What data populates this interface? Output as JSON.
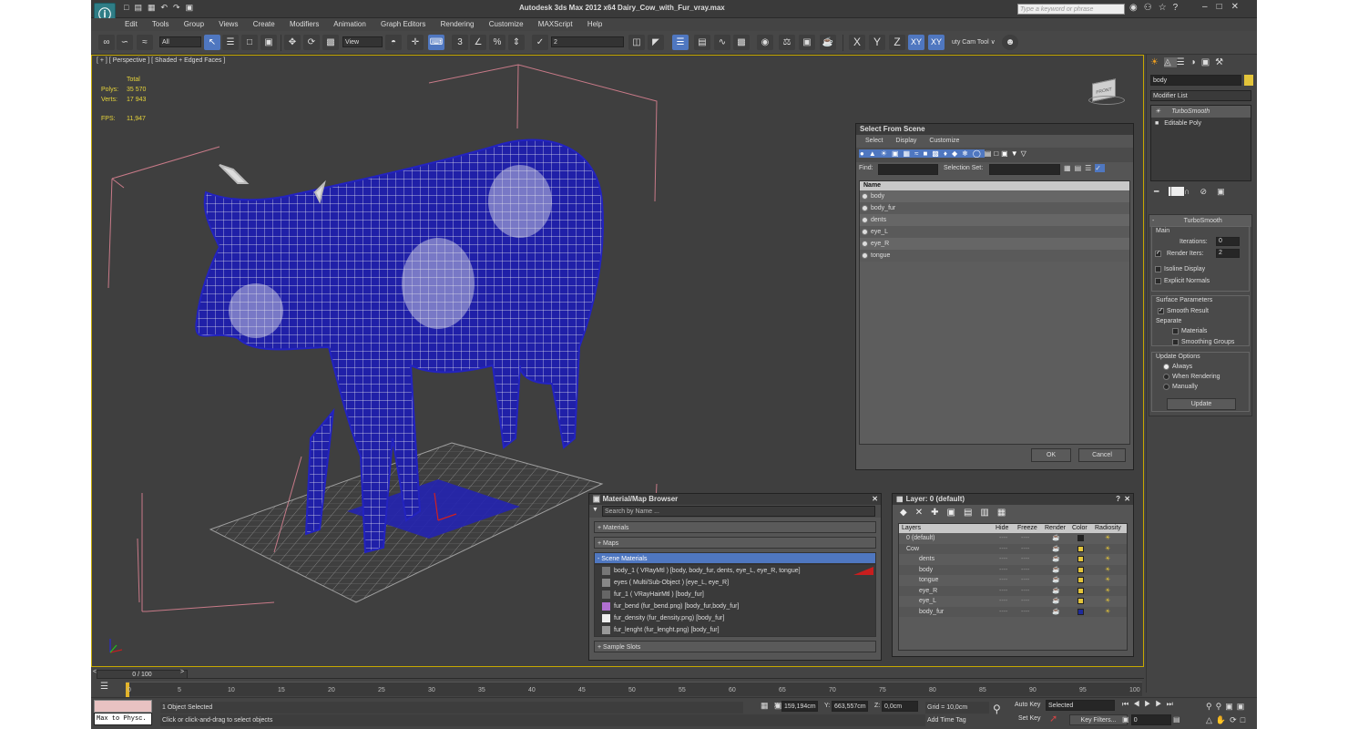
{
  "app": {
    "title": "Autodesk 3ds Max  2012 x64     Dairy_Cow_with_Fur_vray.max",
    "search_placeholder": "Type a keyword or phrase"
  },
  "menu": [
    "Edit",
    "Tools",
    "Group",
    "Views",
    "Create",
    "Modifiers",
    "Animation",
    "Graph Editors",
    "Rendering",
    "Customize",
    "MAXScript",
    "Help"
  ],
  "toolbar": {
    "filter": "All",
    "ref_coord": "View",
    "named_sel": "2",
    "axes": [
      "X",
      "Y",
      "Z",
      "XY",
      "XY"
    ],
    "extra": "uty Cam Tool ∨"
  },
  "viewport": {
    "label": "[ + ] [ Perspective ] [ Shaded + Edged Faces ]",
    "stats": {
      "header": "Total",
      "polys_label": "Polys:",
      "polys": "35 570",
      "verts_label": "Verts:",
      "verts": "17 943",
      "fps_label": "FPS:",
      "fps": "11,947"
    },
    "viewcube": "FRONT"
  },
  "select_scene": {
    "title": "Select From Scene",
    "menu": [
      "Select",
      "Display",
      "Customize"
    ],
    "find_label": "Find:",
    "selset_label": "Selection Set:",
    "col_name": "Name",
    "items": [
      "body",
      "body_fur",
      "dents",
      "eye_L",
      "eye_R",
      "tongue"
    ],
    "ok": "OK",
    "cancel": "Cancel"
  },
  "material_browser": {
    "title": "Material/Map Browser",
    "search": "Search by Name ...",
    "sections": [
      "+ Materials",
      "+ Maps",
      "- Scene Materials"
    ],
    "sample_slots": "+ Sample Slots",
    "items": [
      "body_1  ( VRayMtl ) [body, body_fur, dents, eye_L, eye_R, tongue]",
      "eyes  ( Multi/Sub-Object ) [eye_L, eye_R]",
      "fur_1  ( VRayHairMtl ) [body_fur]",
      "fur_bend (fur_bend.png) [body_fur,body_fur]",
      "fur_density (fur_density.png) [body_fur]",
      "fur_lenght (fur_lenght.png) [body_fur]"
    ]
  },
  "layer_manager": {
    "title": "Layer: 0 (default)",
    "help": "?",
    "columns": [
      "Layers",
      "Hide",
      "Freeze",
      "Render",
      "Color",
      "Radiosity"
    ],
    "rows": [
      {
        "name": "0 (default)",
        "indent": 0,
        "color": "#222222"
      },
      {
        "name": "Cow",
        "indent": 0,
        "color": "#e3c43a"
      },
      {
        "name": "dents",
        "indent": 1,
        "color": "#e3c43a"
      },
      {
        "name": "body",
        "indent": 1,
        "color": "#e3c43a"
      },
      {
        "name": "tongue",
        "indent": 1,
        "color": "#e3c43a"
      },
      {
        "name": "eye_R",
        "indent": 1,
        "color": "#e3c43a"
      },
      {
        "name": "eye_L",
        "indent": 1,
        "color": "#e3c43a"
      },
      {
        "name": "body_fur",
        "indent": 1,
        "color": "#1e2a9c"
      }
    ],
    "dash": "----"
  },
  "command_panel": {
    "object_name": "body",
    "modifier_list": "Modifier List",
    "stack": [
      "TurboSmooth",
      "Editable Poly"
    ],
    "rollout_title": "TurboSmooth",
    "main": "Main",
    "iterations_label": "Iterations:",
    "iterations": "0",
    "render_iters_label": "Render Iters:",
    "render_iters": "2",
    "isoline": "Isoline Display",
    "explicit": "Explicit Normals",
    "surface": "Surface Parameters",
    "smooth_result": "Smooth Result",
    "separate": "Separate",
    "materials": "Materials",
    "smoothing_groups": "Smoothing Groups",
    "update_options": "Update Options",
    "always": "Always",
    "when_rendering": "When Rendering",
    "manually": "Manually",
    "update": "Update"
  },
  "timeline": {
    "frame": "0 / 100",
    "ticks": [
      "0",
      "5",
      "10",
      "15",
      "20",
      "25",
      "30",
      "35",
      "40",
      "45",
      "50",
      "55",
      "60",
      "65",
      "70",
      "75",
      "80",
      "85",
      "90",
      "95",
      "100"
    ]
  },
  "status": {
    "selected": "1 Object Selected",
    "prompt": "Click or click-and-drag to select objects",
    "listener": "Max to Physc.",
    "x_label": "X:",
    "x": "159,194cm",
    "y_label": "Y:",
    "y": "663,557cm",
    "z_label": "Z:",
    "z": "0,0cm",
    "grid": "Grid = 10,0cm",
    "add_time_tag": "Add Time Tag",
    "auto_key": "Auto Key",
    "set_key": "Set Key",
    "key_mode": "Selected",
    "key_filters": "Key Filters...",
    "frame": "0"
  },
  "colors": {
    "accent": "#4f77c0",
    "viewport_border": "#c6a800",
    "wire": "#1a1aa8",
    "stats": "#e7d43a"
  }
}
